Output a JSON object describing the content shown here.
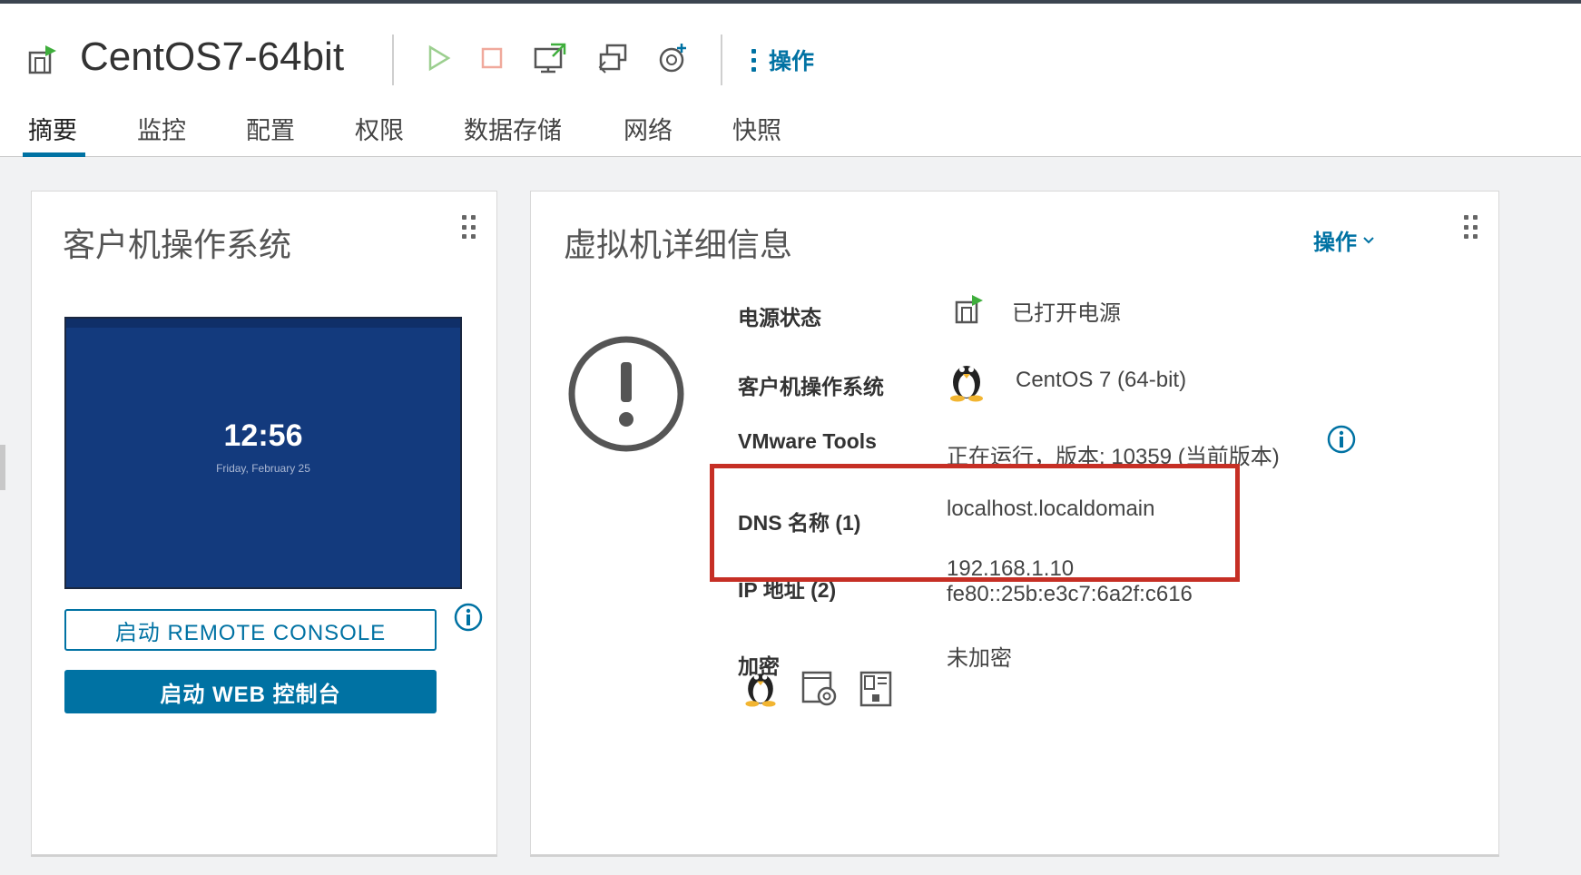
{
  "vm": {
    "name": "CentOS7-64bit"
  },
  "toolbar": {
    "actions_label": "操作",
    "buttons": [
      "power-on",
      "power-off",
      "launch-console",
      "migrate",
      "snapshot"
    ]
  },
  "tabs": [
    {
      "label": "摘要",
      "active": true
    },
    {
      "label": "监控"
    },
    {
      "label": "配置"
    },
    {
      "label": "权限"
    },
    {
      "label": "数据存储"
    },
    {
      "label": "网络"
    },
    {
      "label": "快照"
    }
  ],
  "guest_os_card": {
    "title": "客户机操作系统",
    "console": {
      "time": "12:56",
      "date": "Friday, February 25"
    },
    "remote_console_button": "启动 REMOTE CONSOLE",
    "web_console_button": "启动 WEB 控制台"
  },
  "details_card": {
    "title": "虚拟机详细信息",
    "actions_label": "操作",
    "rows": {
      "power_state": {
        "label": "电源状态",
        "value": "已打开电源"
      },
      "guest_os": {
        "label": "客户机操作系统",
        "value": "CentOS 7 (64-bit)"
      },
      "vmware_tools": {
        "label": "VMware Tools",
        "value": "正在运行，版本: 10359 (当前版本)"
      },
      "dns_name": {
        "label": "DNS 名称 (1)",
        "value": "localhost.localdomain"
      },
      "ip_address": {
        "label": "IP 地址 (2)",
        "values": [
          "192.168.1.10",
          "fe80::25b:e3c7:6a2f:c616"
        ]
      },
      "encryption": {
        "label": "加密",
        "value": "未加密"
      }
    },
    "bottom_icons": [
      "linux-penguin-icon",
      "vm-settings-gear-icon",
      "vm-document-icon"
    ]
  },
  "colors": {
    "accent": "#0072a3",
    "highlight": "#c62f25",
    "power_green": "#3fae3c"
  }
}
